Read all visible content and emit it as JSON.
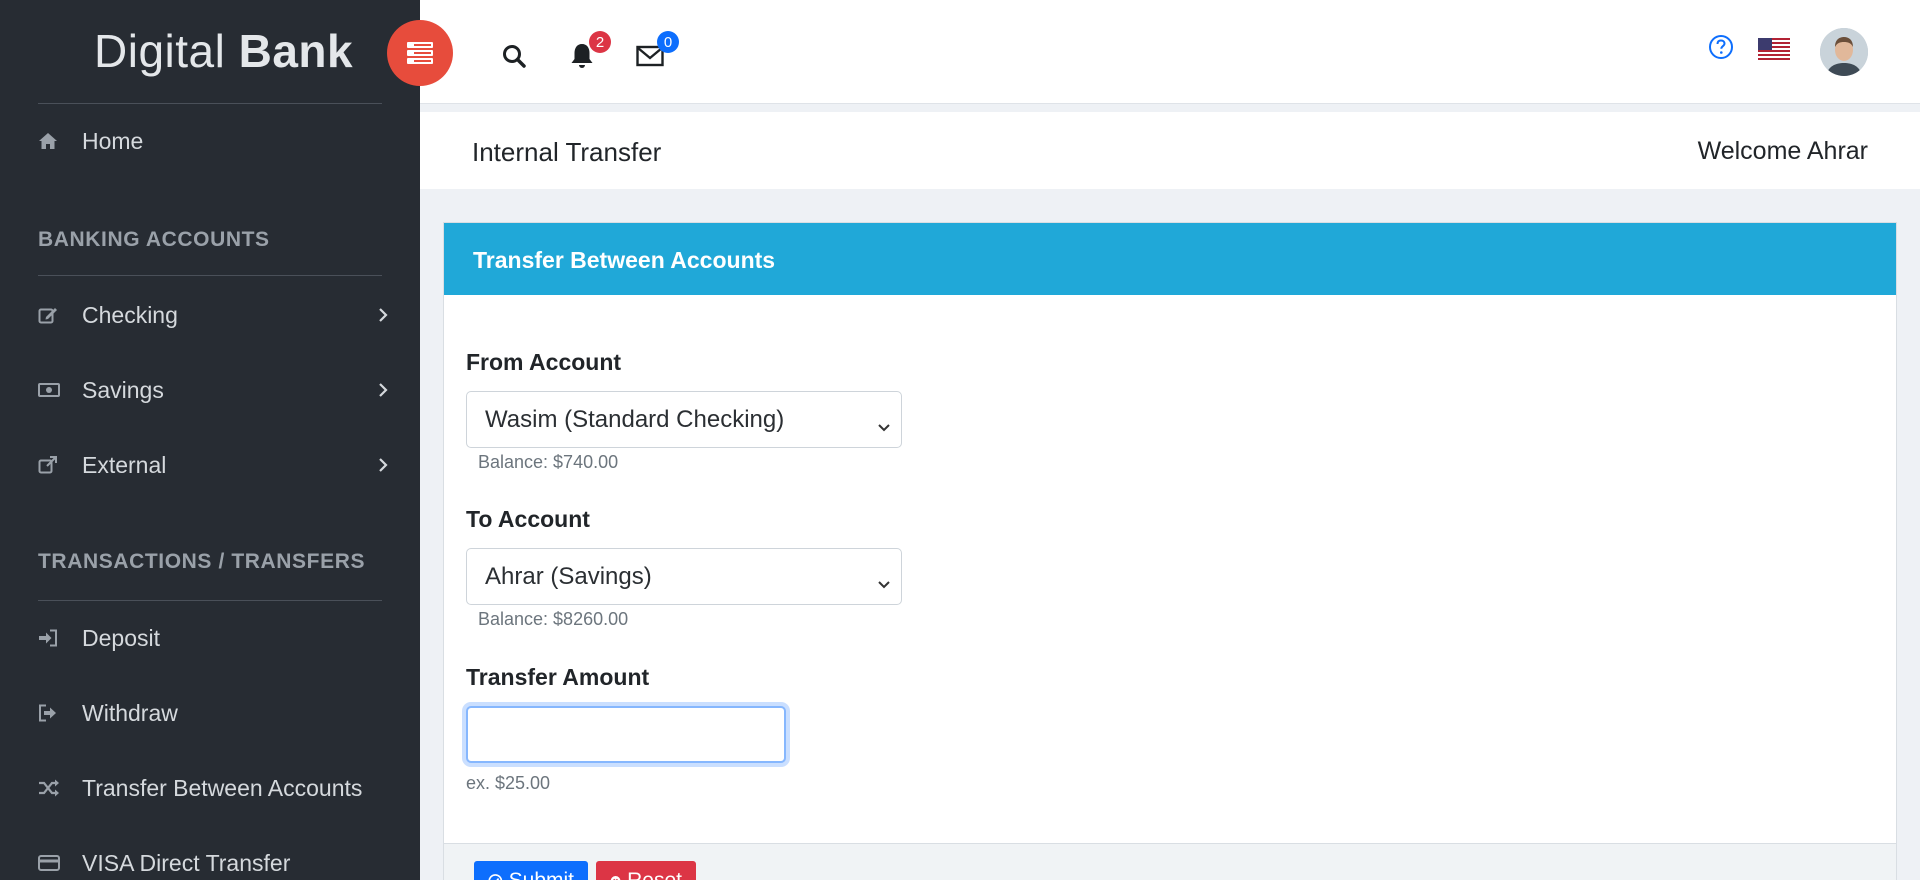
{
  "brand": {
    "part1": "Digital ",
    "part2": "Bank"
  },
  "sidebar": {
    "home": "Home",
    "section_banking": "BANKING ACCOUNTS",
    "checking": "Checking",
    "savings": "Savings",
    "external": "External",
    "section_transactions": "TRANSACTIONS / TRANSFERS",
    "deposit": "Deposit",
    "withdraw": "Withdraw",
    "transfer": "Transfer Between Accounts",
    "visa": "VISA Direct Transfer"
  },
  "header": {
    "notifications_count": "2",
    "messages_count": "0",
    "icons": [
      "search-icon",
      "bell-icon",
      "envelope-icon",
      "help-icon",
      "us-flag-icon",
      "user-avatar"
    ],
    "colors": {
      "notif_badge": "#dc3545",
      "msg_badge": "#0d6efd",
      "toggle": "#e74c3c"
    }
  },
  "page": {
    "title": "Internal Transfer",
    "welcome": "Welcome Ahrar"
  },
  "form": {
    "card_title": "Transfer Between Accounts",
    "from_label": "From Account",
    "from_value": "Wasim (Standard Checking)",
    "from_balance": "Balance: $740.00",
    "to_label": "To Account",
    "to_value": "Ahrar (Savings)",
    "to_balance": "Balance: $8260.00",
    "amount_label": "Transfer Amount",
    "amount_value": "",
    "amount_hint": "ex. $25.00",
    "submit_label": "Submit",
    "reset_label": "Reset",
    "colors": {
      "card_header": "#20a8d8",
      "submit": "#0d6efd",
      "reset": "#dc3545"
    }
  }
}
